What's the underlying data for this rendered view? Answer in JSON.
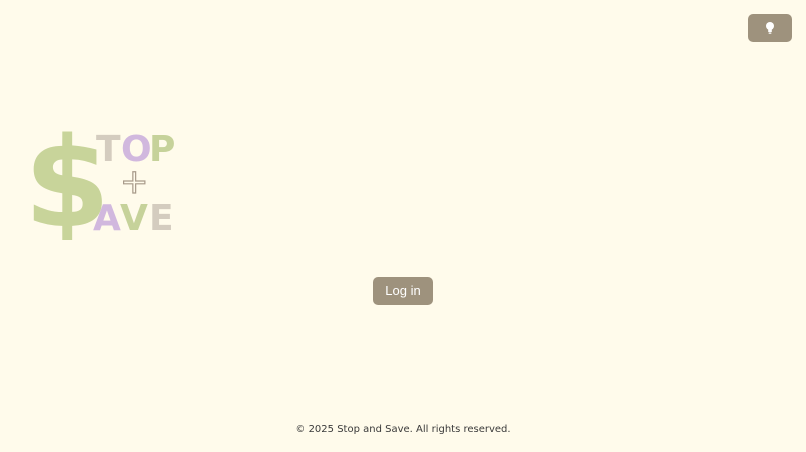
{
  "header": {
    "theme_toggle_icon": "lightbulb-icon"
  },
  "logo": {
    "dollar_glyph": "$",
    "word_top": "TOP",
    "plus_glyph": "+",
    "word_bottom": "AVE",
    "colors": {
      "dollar": "#c8d49a",
      "t": "#d4ccbf",
      "o": "#d1b8de",
      "p": "#c6d29a",
      "a": "#d1b8de",
      "v": "#c6d29a",
      "e": "#d4ccbf",
      "plus_outline": "#a89a8a"
    }
  },
  "main": {
    "login_label": "Log in"
  },
  "footer": {
    "copyright": "© 2025 Stop and Save. All rights reserved."
  },
  "colors": {
    "background": "#fffbeb",
    "button": "#9e927d",
    "button_text": "#ffffff"
  }
}
